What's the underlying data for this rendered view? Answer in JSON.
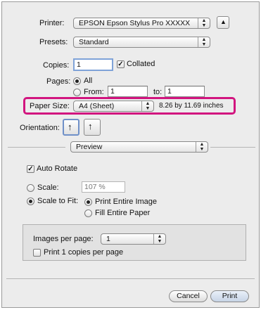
{
  "printer": {
    "label": "Printer:",
    "value": "EPSON Epson Stylus Pro XXXXX"
  },
  "presets": {
    "label": "Presets:",
    "value": "Standard"
  },
  "copies": {
    "label": "Copies:",
    "value": "1",
    "collated_label": "Collated",
    "collated_checked": true
  },
  "pages": {
    "label": "Pages:",
    "all_label": "All",
    "from_label": "From:",
    "from_value": "1",
    "to_label": "to:",
    "to_value": "1"
  },
  "paper_size": {
    "label": "Paper Size:",
    "value": "A4 (Sheet)",
    "dimensions": "8.26 by 11.69 inches",
    "highlight_color": "#d2157f"
  },
  "orientation": {
    "label": "Orientation:"
  },
  "section": {
    "value": "Preview"
  },
  "auto_rotate": {
    "label": "Auto Rotate",
    "checked": true
  },
  "scale": {
    "label": "Scale:",
    "value": "107 %"
  },
  "scale_to_fit": {
    "label": "Scale to Fit:",
    "print_entire_label": "Print Entire Image",
    "fill_entire_label": "Fill Entire Paper"
  },
  "images_per_page": {
    "label": "Images per page:",
    "value": "1"
  },
  "print_copies": {
    "label": "Print 1 copies per page"
  },
  "buttons": {
    "cancel": "Cancel",
    "print": "Print"
  }
}
